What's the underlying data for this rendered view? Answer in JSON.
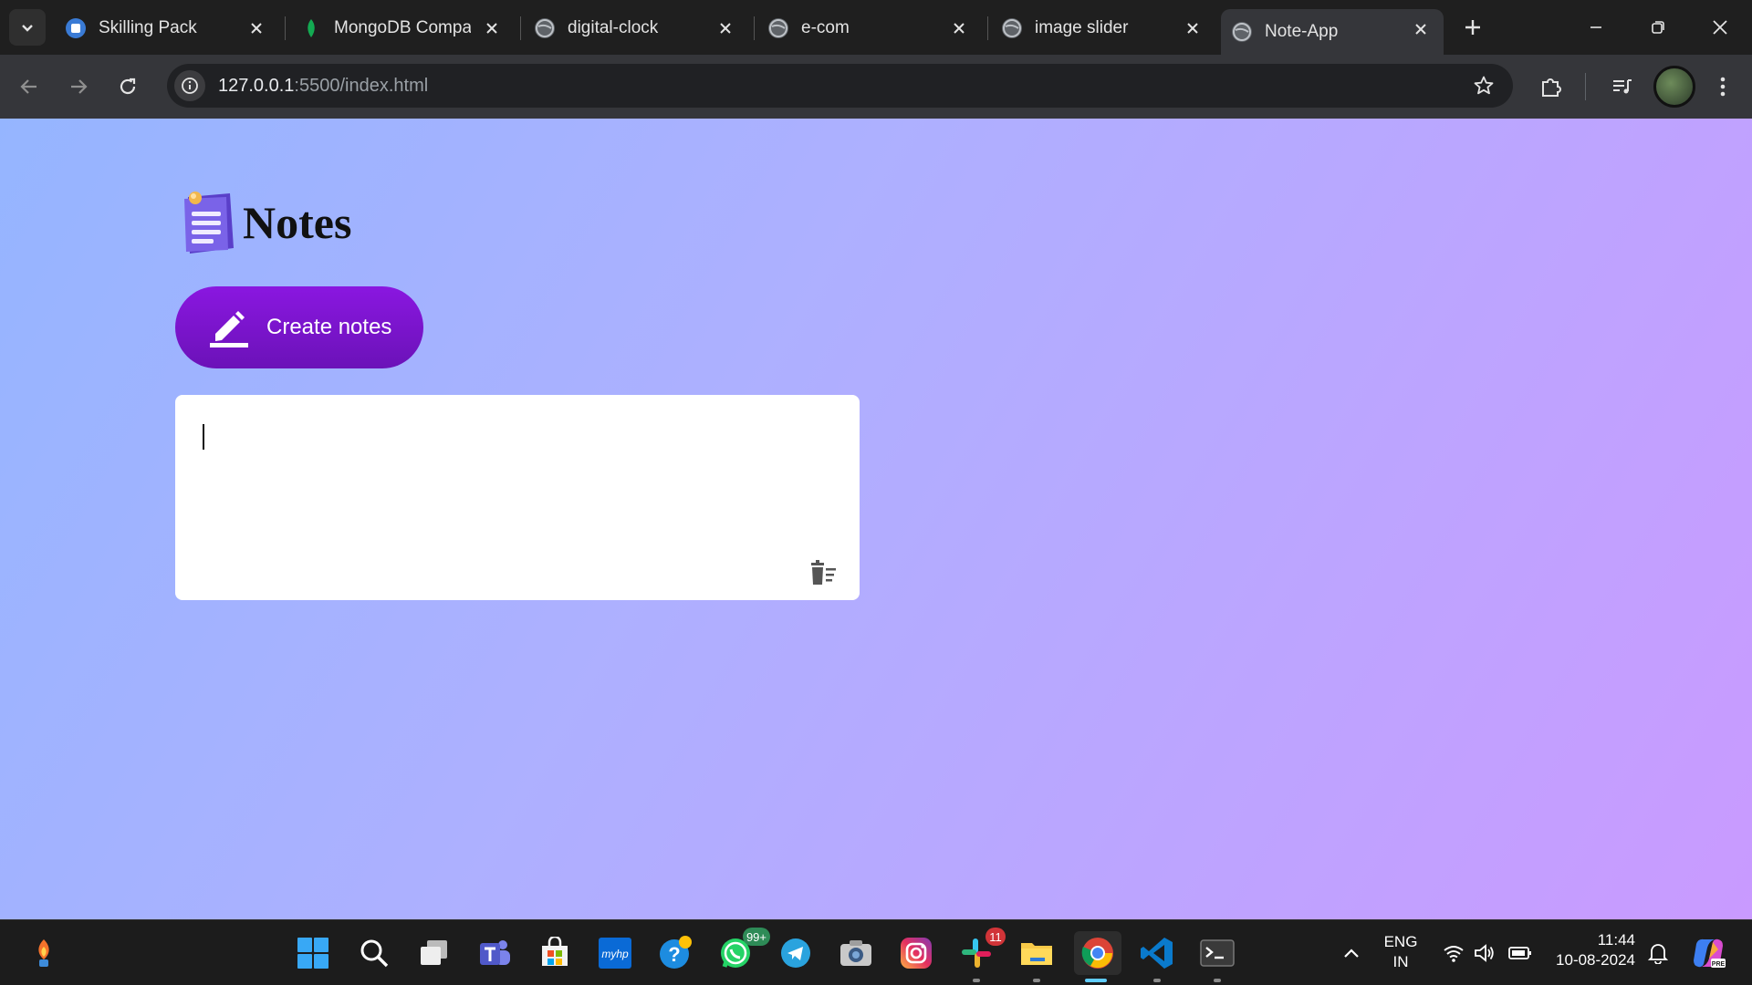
{
  "browser": {
    "tabs": [
      {
        "title": "Skilling Pack",
        "active": false
      },
      {
        "title": "MongoDB Compass",
        "active": false
      },
      {
        "title": "digital-clock",
        "active": false
      },
      {
        "title": "e-com",
        "active": false
      },
      {
        "title": "image slider",
        "active": false
      },
      {
        "title": "Note-App",
        "active": true
      }
    ],
    "url": {
      "host": "127.0.0.1",
      "rest": ":5500/index.html"
    }
  },
  "page": {
    "heading": "Notes",
    "create_button_label": "Create notes",
    "note_text": ""
  },
  "taskbar": {
    "whatsapp_badge": "99+",
    "slack_badge": "11",
    "language_line1": "ENG",
    "language_line2": "IN",
    "time": "11:44",
    "date": "10-08-2024"
  },
  "colors": {
    "page_gradient_start": "#95b5ff",
    "page_gradient_end": "#c99aff",
    "create_button": "#7a15cc",
    "card": "#ffffff"
  }
}
